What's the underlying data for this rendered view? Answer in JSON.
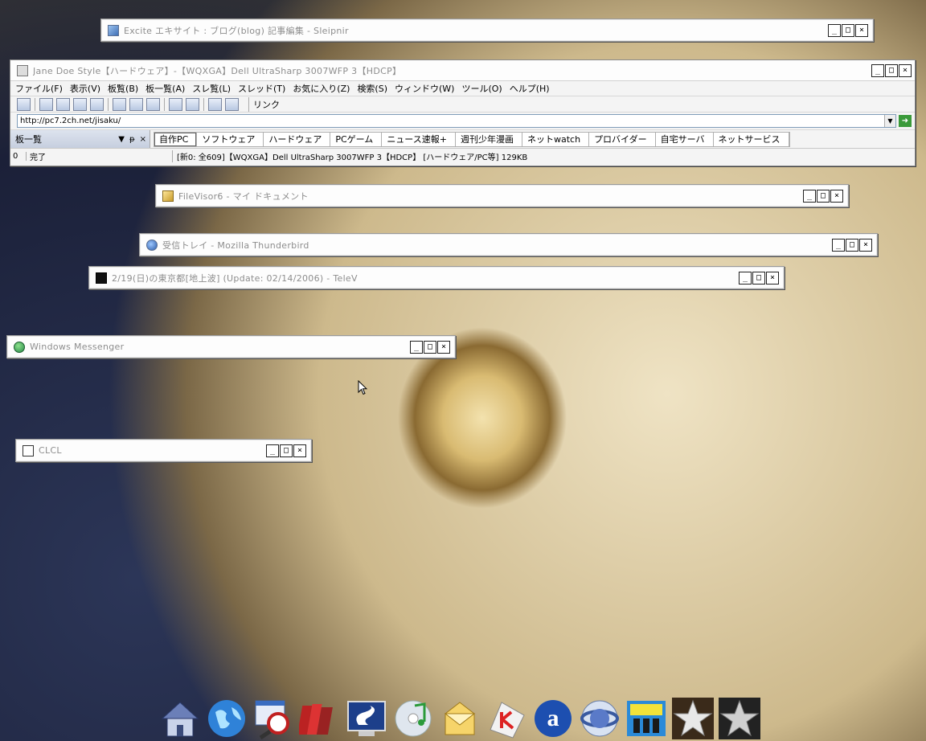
{
  "windows": {
    "sleipnir": {
      "title": "Excite エキサイト : ブログ(blog) 記事編集 - Sleipnir"
    },
    "filevisor": {
      "title": "FileVisor6 - マイ ドキュメント"
    },
    "thunderbird": {
      "title": "受信トレイ - Mozilla Thunderbird"
    },
    "telev": {
      "title": "2/19(日)の東京都[地上波] (Update: 02/14/2006) - TeleV"
    },
    "messenger": {
      "title": "Windows Messenger"
    },
    "clcl": {
      "title": "CLCL"
    }
  },
  "controls": {
    "minimize": "_",
    "maximize": "□",
    "close": "×"
  },
  "jane": {
    "title": "Jane Doe Style【ハードウェア】-【WQXGA】Dell UltraSharp 3007WFP 3【HDCP】",
    "menu": [
      "ファイル(F)",
      "表示(V)",
      "板覧(B)",
      "板一覧(A)",
      "スレ覧(L)",
      "スレッド(T)",
      "お気に入り(Z)",
      "検索(S)",
      "ウィンドウ(W)",
      "ツール(O)",
      "ヘルプ(H)"
    ],
    "link_label": "リンク",
    "address": "http://pc7.2ch.net/jisaku/",
    "pane_label": "板一覧",
    "pane_buttons": [
      "▼",
      "ᵽ",
      "×"
    ],
    "tabs": [
      "自作PC",
      "ソフトウェア",
      "ハードウェア",
      "PCゲーム",
      "ニュース速報+",
      "週刊少年漫画",
      "ネットwatch",
      "プロバイダー",
      "自宅サーバ",
      "ネットサービス"
    ],
    "status": {
      "count": "0",
      "state": "完了",
      "info": "[新0: 全609]【WQXGA】Dell UltraSharp 3007WFP 3【HDCP】 [ハードウェア/PC等] 129KB"
    }
  },
  "dock": [
    "home-icon",
    "globe-icon",
    "magnifier-icon",
    "books-icon",
    "sleipnir-icon",
    "music-cd-icon",
    "mail-icon",
    "app-k-icon",
    "amazon-icon",
    "browser-globe-icon",
    "tv-icon",
    "star-icon",
    "star-silver-icon"
  ]
}
